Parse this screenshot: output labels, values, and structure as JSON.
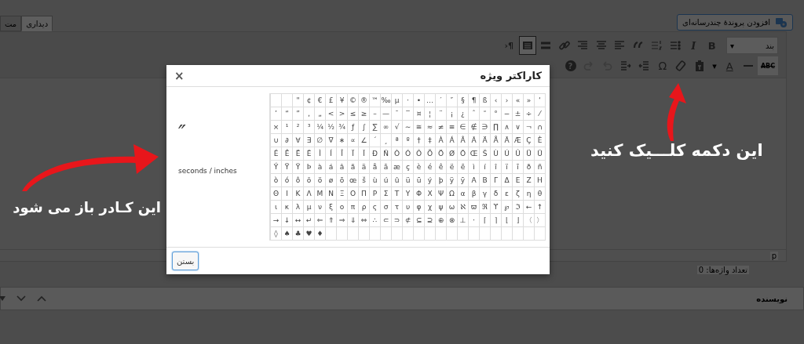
{
  "editor": {
    "media_button": "افزودن پروندهٔ چندرسانه‌ای",
    "tabs": [
      {
        "label": "دیداری",
        "selected": true
      },
      {
        "label": "مت",
        "selected": false
      }
    ],
    "toolbar_rows": [
      [
        {
          "kind": "format-select",
          "label": "بند",
          "caret": "▾"
        },
        {
          "kind": "bold",
          "label": "B",
          "on": false,
          "disabled": false
        },
        {
          "kind": "italic",
          "label": "I",
          "on": false,
          "disabled": false
        },
        {
          "kind": "bullet-list",
          "on": false,
          "disabled": false
        },
        {
          "kind": "number-list",
          "on": false,
          "disabled": false
        },
        {
          "kind": "quote",
          "on": false,
          "disabled": false
        },
        {
          "kind": "align-left",
          "on": false,
          "disabled": false
        },
        {
          "kind": "align-center",
          "on": false,
          "disabled": false
        },
        {
          "kind": "align-right",
          "on": false,
          "disabled": false
        },
        {
          "kind": "link",
          "on": false,
          "disabled": false
        },
        {
          "kind": "more",
          "on": false,
          "disabled": false
        },
        {
          "kind": "toolbar-toggle",
          "on": true,
          "disabled": false
        },
        {
          "kind": "direction",
          "label": "¶‹",
          "on": false,
          "disabled": false
        }
      ],
      [
        {
          "kind": "strike",
          "label": "ABC",
          "on": false,
          "disabled": false
        },
        {
          "kind": "hr",
          "on": false,
          "disabled": false
        },
        {
          "kind": "text-color",
          "label": "A",
          "on": false,
          "disabled": false
        },
        {
          "kind": "caret",
          "label": "▾",
          "on": false,
          "disabled": false
        },
        {
          "kind": "paste-text",
          "on": false,
          "disabled": false
        },
        {
          "kind": "eraser",
          "on": false,
          "disabled": false
        },
        {
          "kind": "omega",
          "label": "Ω",
          "on": false,
          "disabled": false
        },
        {
          "kind": "outdent",
          "on": false,
          "disabled": false
        },
        {
          "kind": "indent",
          "on": false,
          "disabled": false
        },
        {
          "kind": "undo",
          "on": false,
          "disabled": true
        },
        {
          "kind": "redo",
          "on": false,
          "disabled": true
        },
        {
          "kind": "help",
          "label": "?",
          "on": false,
          "disabled": false
        }
      ]
    ],
    "path": "p",
    "word_count": "تعداد واژه‌ها: 0"
  },
  "author_box": {
    "title": "نویسنده"
  },
  "dialog": {
    "title": "کاراکتر ویژه",
    "close": "×",
    "preview_char": "″",
    "preview_name": "seconds / inches",
    "grid": [
      [
        "‘",
        "»",
        "«",
        "›",
        "‹",
        "ß",
        "¶",
        "§",
        "″",
        "′",
        "…",
        "•",
        "·",
        "µ",
        "‰",
        "™",
        "®",
        "©",
        "¥",
        "£",
        "€",
        "¢",
        "\""
      ],
      [
        "⁄",
        "÷",
        "±",
        "−",
        "°",
        "˜",
        "ˆ",
        "¿",
        "¡",
        "¨",
        "¦",
        "¤",
        "‾",
        "¯",
        "—",
        "–",
        "≥",
        "≤",
        ">",
        "<",
        "„",
        "‚",
        "”",
        "“",
        "’"
      ],
      [
        "∩",
        "¬",
        "∨",
        "∧",
        "∏",
        "∋",
        "∉",
        "∈",
        "≡",
        "≠",
        "≈",
        "≅",
        "∼",
        "√",
        "∞",
        "∑",
        "∫",
        "ƒ",
        "¾",
        "½",
        "¼",
        "³",
        "²",
        "¹",
        "×"
      ],
      [
        "È",
        "Ç",
        "Æ",
        "Ā",
        "Å",
        "Ä",
        "Ã",
        "Â",
        "Á",
        "À",
        "‡",
        "†",
        "º",
        "ª",
        "¸",
        "´",
        "∠",
        "∝",
        "∗",
        "∇",
        "∅",
        "∃",
        "∀",
        "∂",
        "∪"
      ],
      [
        "Ū",
        "Ü",
        "Û",
        "Ú",
        "Ù",
        "Š",
        "Œ",
        "Ō",
        "Ø",
        "Ö",
        "Õ",
        "Ô",
        "Ó",
        "Ò",
        "Ñ",
        "Ð",
        "Ī",
        "Ï",
        "Î",
        "Í",
        "Ì",
        "Ē",
        "Ë",
        "Ê",
        "É"
      ],
      [
        "ñ",
        "ð",
        "ī",
        "ï",
        "î",
        "í",
        "ì",
        "ē",
        "ë",
        "ê",
        "é",
        "è",
        "ç",
        "æ",
        "ā",
        "å",
        "ä",
        "ã",
        "â",
        "á",
        "à",
        "Þ",
        "Ȳ",
        "Ÿ",
        "Ý"
      ],
      [
        "Η",
        "Ζ",
        "Ε",
        "Δ",
        "Γ",
        "Β",
        "Α",
        "ȳ",
        "ÿ",
        "þ",
        "ý",
        "ū",
        "ü",
        "û",
        "ú",
        "ù",
        "š",
        "œ",
        "ō",
        "ø",
        "ö",
        "õ",
        "ô",
        "ó",
        "ò"
      ],
      [
        "θ",
        "η",
        "ζ",
        "ε",
        "δ",
        "γ",
        "β",
        "α",
        "Ω",
        "Ψ",
        "Χ",
        "Φ",
        "Υ",
        "Τ",
        "Σ",
        "Ρ",
        "Π",
        "Ο",
        "Ξ",
        "Ν",
        "Μ",
        "Λ",
        "Κ",
        "Ι",
        "Θ"
      ],
      [
        "↑",
        "←",
        "ℑ",
        "℘",
        "ϒ",
        "ℜ",
        "ϖ",
        "ℵ",
        "ω",
        "ψ",
        "χ",
        "φ",
        "υ",
        "τ",
        "σ",
        "ς",
        "ρ",
        "π",
        "ο",
        "ξ",
        "ν",
        "μ",
        "λ",
        "κ",
        "ι"
      ],
      [
        "〉",
        "〈",
        "⌋",
        "⌊",
        "⌉",
        "⌈",
        "⋅",
        "⊥",
        "⊗",
        "⊕",
        "⊇",
        "⊆",
        "⊄",
        "⊃",
        "⊂",
        "∴",
        "⇔",
        "⇓",
        "⇒",
        "⇑",
        "⇐",
        "↵",
        "↔",
        "↓",
        "→"
      ],
      [
        "♦",
        "♥",
        "♣",
        "♠",
        "◊"
      ]
    ],
    "close_button": "بستن"
  },
  "annotations": [
    {
      "kind": "click-hint",
      "text": "این دکمه کلـــیک کنید"
    },
    {
      "kind": "opens-hint",
      "text": "این کـادر باز می شود"
    }
  ]
}
